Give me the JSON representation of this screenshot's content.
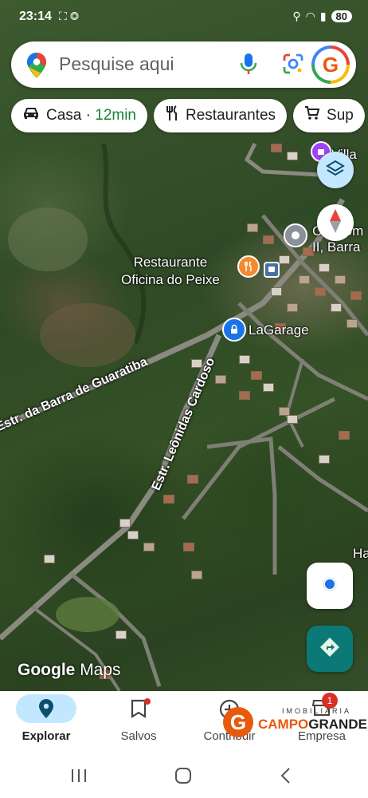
{
  "status_bar": {
    "time": "23:14",
    "battery": "80"
  },
  "search": {
    "placeholder": "Pesquise aqui"
  },
  "chips": [
    {
      "label": "Casa",
      "sep": "·",
      "eta": "12min"
    },
    {
      "label": "Restaurantes"
    },
    {
      "label": "Sup"
    }
  ],
  "map": {
    "places": [
      {
        "name": "Restaurante\nOficina do Peixe"
      },
      {
        "name": "LaGarage"
      },
      {
        "name": "Villa"
      },
      {
        "name": "Condom\nII, Barra"
      },
      {
        "name": "Ha"
      }
    ],
    "roads": [
      {
        "name": "Estr. da Barra de Guaratiba"
      },
      {
        "name": "Estr. Leônidas Cardoso"
      }
    ]
  },
  "attribution": {
    "google": "Google",
    "maps": "Maps"
  },
  "bottom_nav": [
    {
      "label": "Explorar",
      "active": true
    },
    {
      "label": "Salvos"
    },
    {
      "label": "Contribuir"
    },
    {
      "label": "Empresa",
      "badge": "1"
    }
  ],
  "watermark": {
    "line1": "IMOBILIÁRIA",
    "line2a": "CAMPO",
    "line2b": "GRANDE"
  },
  "colors": {
    "accent": "#1a73e8",
    "route_fab": "#0b7a76",
    "nav_active": "#c2e7ff"
  }
}
